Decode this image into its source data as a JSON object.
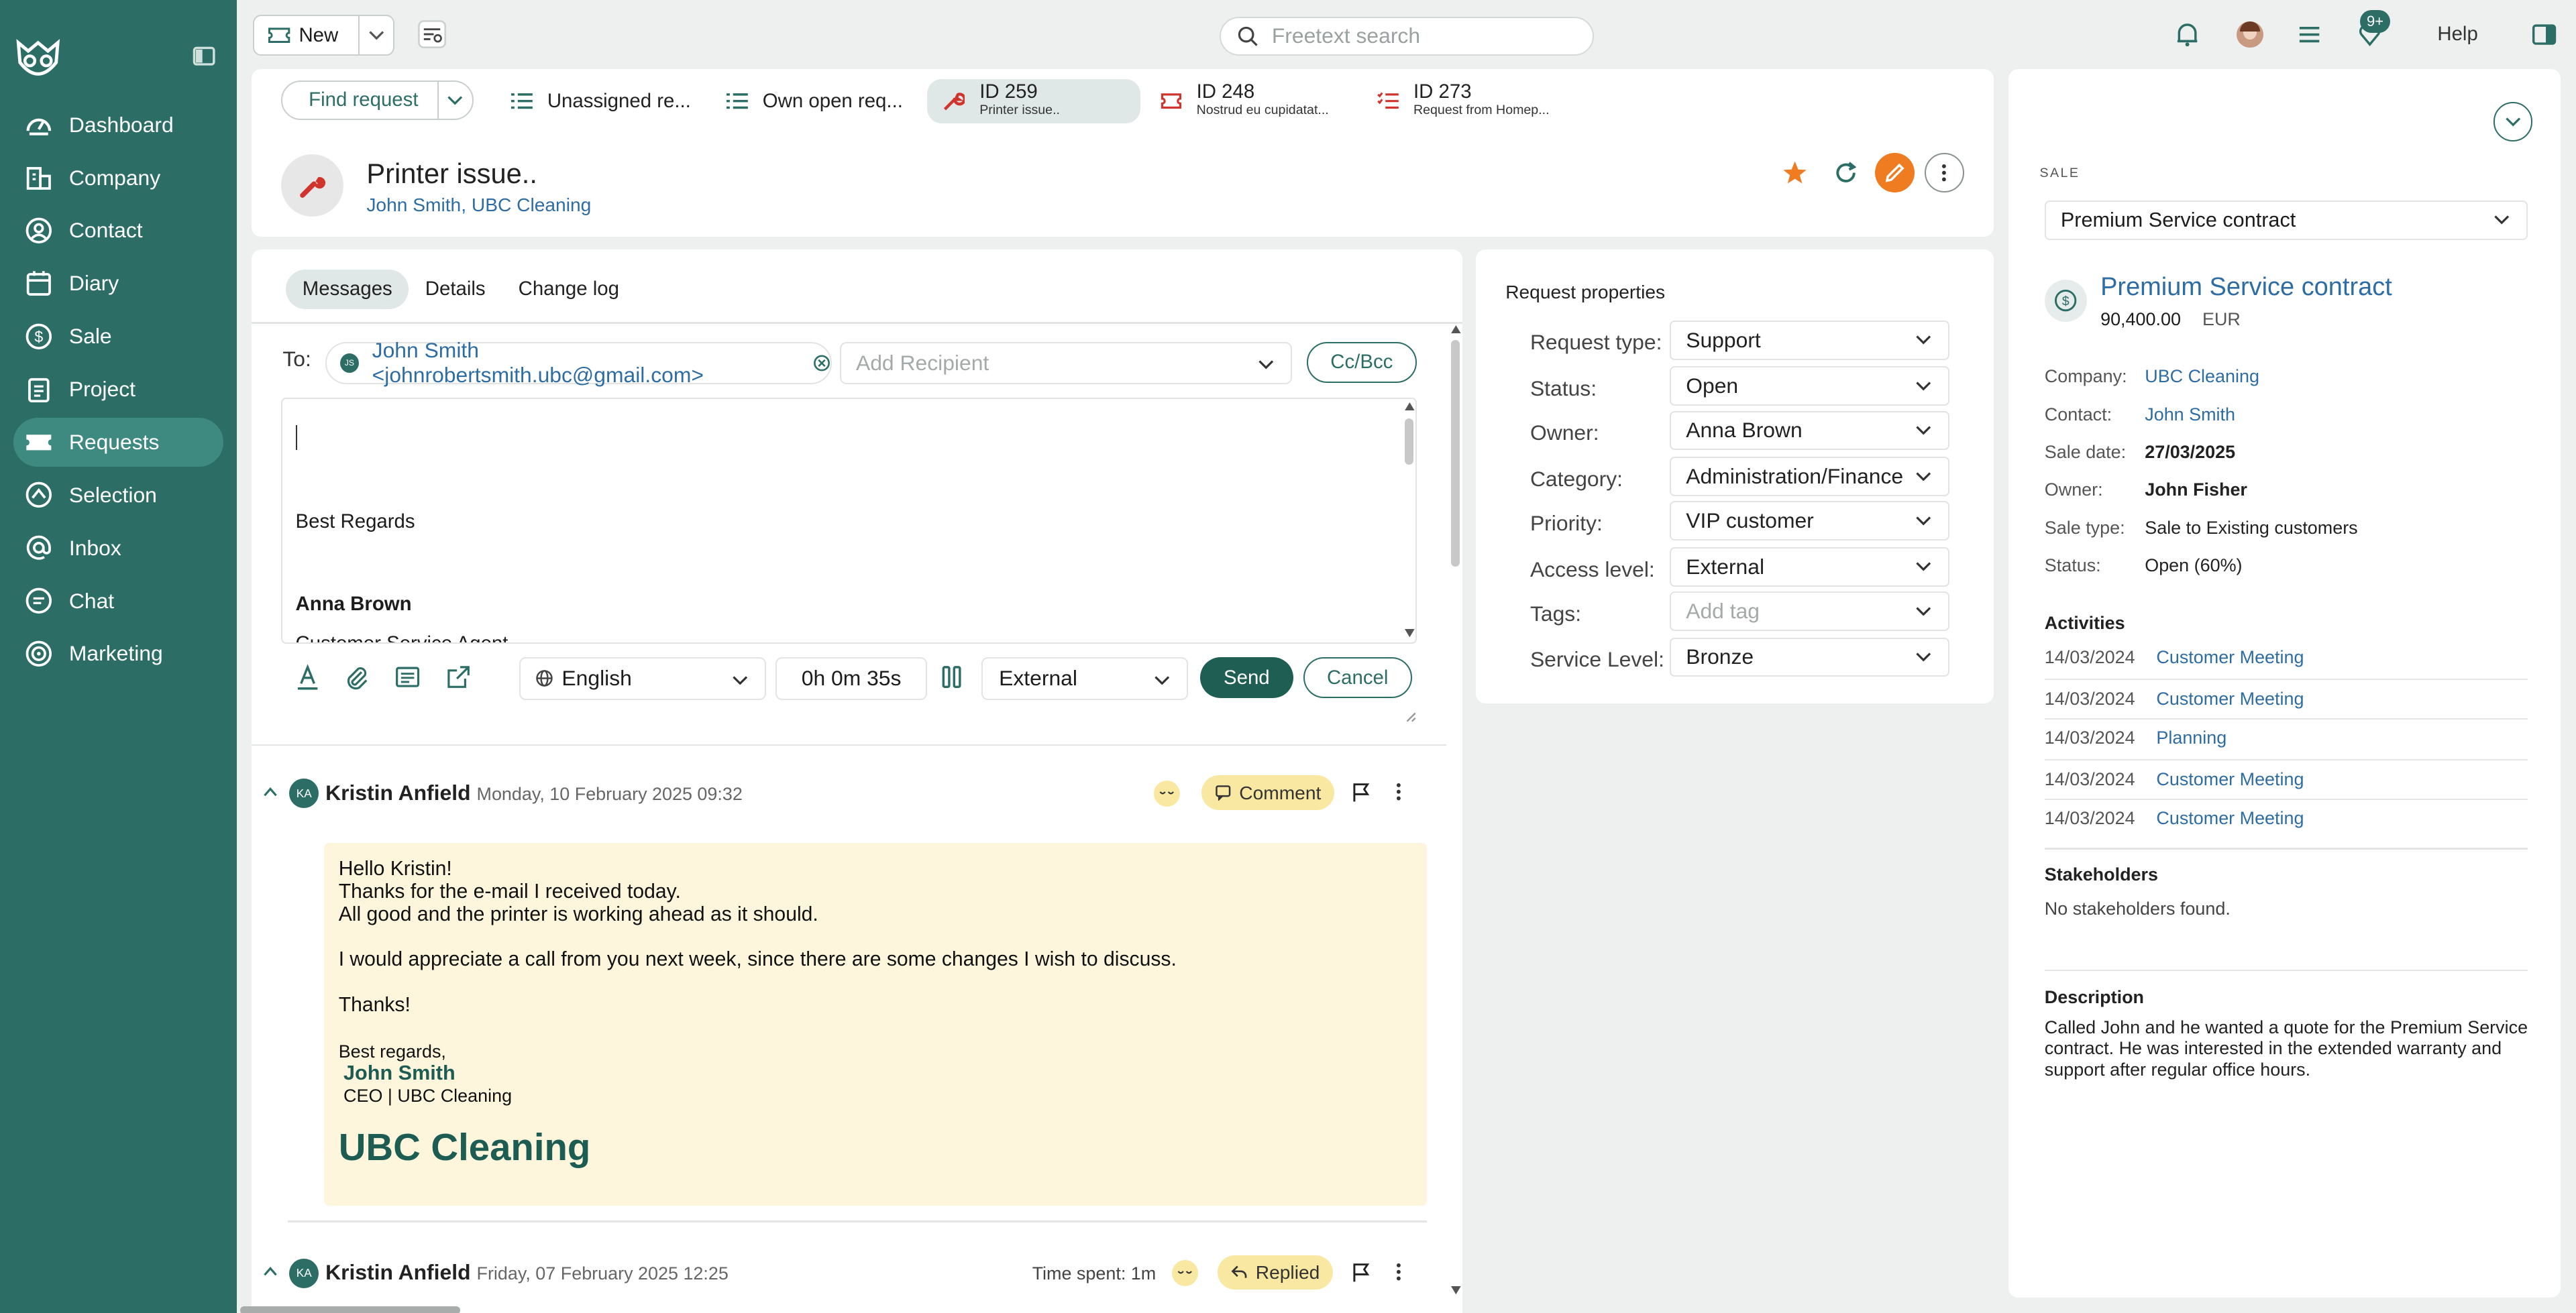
{
  "sidebar": {
    "items": [
      {
        "label": "Dashboard",
        "icon": "dashboard-icon"
      },
      {
        "label": "Company",
        "icon": "company-icon"
      },
      {
        "label": "Contact",
        "icon": "contact-icon"
      },
      {
        "label": "Diary",
        "icon": "diary-icon"
      },
      {
        "label": "Sale",
        "icon": "sale-icon"
      },
      {
        "label": "Project",
        "icon": "project-icon"
      },
      {
        "label": "Requests",
        "icon": "requests-icon",
        "active": true
      },
      {
        "label": "Selection",
        "icon": "selection-icon"
      },
      {
        "label": "Inbox",
        "icon": "inbox-icon"
      },
      {
        "label": "Chat",
        "icon": "chat-icon"
      },
      {
        "label": "Marketing",
        "icon": "marketing-icon"
      }
    ]
  },
  "topbar": {
    "new_label": "New",
    "search_placeholder": "Freetext search",
    "notification_badge": "9+",
    "help_label": "Help"
  },
  "request_tabs": {
    "find_label": "Find request",
    "tabs": [
      {
        "label": "Unassigned re..."
      },
      {
        "label": "Own open req..."
      },
      {
        "label": "ID 259",
        "sub": "Printer issue.."
      },
      {
        "label": "ID 248",
        "sub": "Nostrud eu cupidatat..."
      },
      {
        "label": "ID 273",
        "sub": "Request from Homep..."
      }
    ]
  },
  "request": {
    "title": "Printer issue..",
    "contact": "John Smith",
    "company": "UBC Cleaning",
    "separator": ", "
  },
  "messages": {
    "tabs": [
      "Messages",
      "Details",
      "Change log"
    ],
    "to_label": "To:",
    "recipient_initials": "JS",
    "recipient": "John Smith <johnrobertsmith.ubc@gmail.com>",
    "add_recipient_placeholder": "Add Recipient",
    "ccbcc_label": "Cc/Bcc",
    "editor": {
      "regards": "Best Regards",
      "name": "Anna Brown",
      "job_title": "Customer Service Agent"
    },
    "language": "English",
    "time": "0h 0m 35s",
    "visibility": "External",
    "send_label": "Send",
    "cancel_label": "Cancel",
    "items": [
      {
        "initials": "KA",
        "author": "Kristin Anfield",
        "date": "Monday, 10 February 2025 09:32",
        "type": "Comment",
        "body": {
          "greeting": "Hello Kristin!",
          "line1": "Thanks for the e-mail I received today.",
          "line2": "All good and the printer is working ahead as it should.",
          "line3": "I would appreciate a call from you next week, since there are some changes I wish to discuss.",
          "thanks": "Thanks!",
          "regards": "Best regards,",
          "sig_name": "John Smith",
          "sig_title": "CEO | UBC Cleaning",
          "brand": "UBC Cleaning"
        }
      },
      {
        "initials": "KA",
        "author": "Kristin Anfield",
        "date": "Friday, 07 February 2025 12:25",
        "time_spent": "Time spent: 1m",
        "type": "Replied"
      }
    ]
  },
  "request_properties": {
    "title": "Request properties",
    "fields": [
      {
        "label": "Request type:",
        "value": "Support"
      },
      {
        "label": "Status:",
        "value": "Open"
      },
      {
        "label": "Owner:",
        "value": "Anna Brown"
      },
      {
        "label": "Category:",
        "value": "Administration/Finance"
      },
      {
        "label": "Priority:",
        "value": "VIP customer"
      },
      {
        "label": "Access level:",
        "value": "External"
      },
      {
        "label": "Tags:",
        "value": "",
        "placeholder": "Add tag"
      },
      {
        "label": "Service Level:",
        "value": "Bronze"
      }
    ]
  },
  "sale_panel": {
    "section_label": "SALE",
    "selected": "Premium Service contract",
    "title": "Premium Service contract",
    "amount": "90,400.00",
    "currency": "EUR",
    "fields": [
      {
        "label": "Company:",
        "value": "UBC Cleaning",
        "link": true
      },
      {
        "label": "Contact:",
        "value": "John Smith",
        "link": true
      },
      {
        "label": "Sale date:",
        "value": "27/03/2025",
        "bold": true
      },
      {
        "label": "Owner:",
        "value": "John Fisher",
        "bold": true
      },
      {
        "label": "Sale type:",
        "value": "Sale to Existing customers"
      },
      {
        "label": "Status:",
        "value": "Open (60%)"
      }
    ],
    "activities_label": "Activities",
    "activities": [
      {
        "date": "14/03/2024",
        "name": "Customer Meeting"
      },
      {
        "date": "14/03/2024",
        "name": "Customer Meeting"
      },
      {
        "date": "14/03/2024",
        "name": "Planning"
      },
      {
        "date": "14/03/2024",
        "name": "Customer Meeting"
      },
      {
        "date": "14/03/2024",
        "name": "Customer Meeting"
      }
    ],
    "stakeholders_label": "Stakeholders",
    "stakeholders_empty": "No stakeholders found.",
    "description_label": "Description",
    "description": "Called John and he wanted a quote for the Premium Service contract. He was interested in the extended warranty and support after regular office hours."
  },
  "colors": {
    "sidebar_bg": "#2c6e66",
    "accent": "#1f5e52",
    "link": "#2e6da4",
    "edit_orange": "#f07c22",
    "comment_bg": "#fef6dc"
  }
}
